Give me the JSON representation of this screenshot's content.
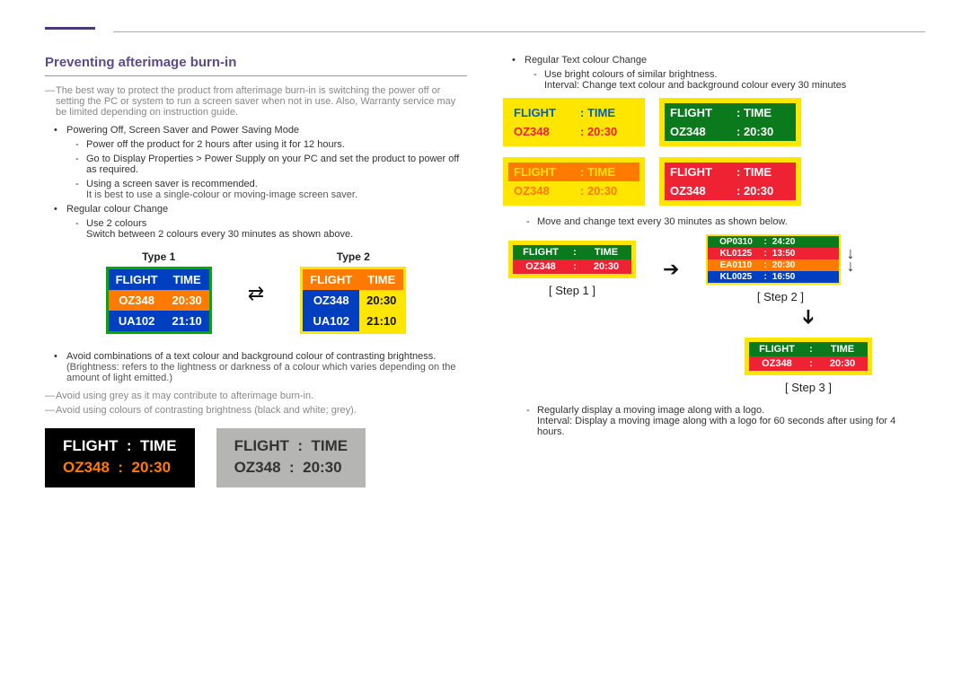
{
  "title": "Preventing afterimage burn-in",
  "intro": "The best way to protect the product from afterimage burn-in is switching the power off or setting the PC or system to run a screen saver when not in use. Also, Warranty service may be limited depending on instruction guide.",
  "b1": "Powering Off, Screen Saver and Power Saving Mode",
  "b1s1": "Power off the product for 2 hours after using it for 12 hours.",
  "b1s2": "Go to Display Properties > Power Supply on your PC and set the product to power off as required.",
  "b1s3": "Using a screen saver is recommended.",
  "b1s3n": "It is best to use a single-colour or moving-image screen saver.",
  "b2": "Regular colour Change",
  "b2s1": "Use 2 colours",
  "b2s1n": "Switch between 2 colours every 30 minutes as shown above.",
  "type1": "Type 1",
  "type2": "Type 2",
  "tbl": {
    "h1": "FLIGHT",
    "h2": "TIME",
    "r1c1": "OZ348",
    "r1c2": "20:30",
    "r2c1": "UA102",
    "r2c2": "21:10"
  },
  "b3": "Avoid combinations of a text colour and background colour of contrasting brightness.",
  "b3n": "(Brightness: refers to the lightness or darkness of a colour which varies depending on the amount of light emitted.)",
  "warn1": "Avoid using grey as it may contribute to afterimage burn-in.",
  "warn2": "Avoid using colours of contrasting brightness (black and white; grey).",
  "bw": {
    "l1a": "FLIGHT",
    "l1b": "TIME",
    "l2a": "OZ348",
    "l2b": "20:30"
  },
  "rc": {
    "title": "Regular Text colour Change",
    "s1": "Use bright colours of similar brightness.",
    "s1n": "Interval: Change text colour and background colour every 30 minutes",
    "s2": "Move and change text every 30 minutes as shown below.",
    "s3": "Regularly display a moving image along with a logo.",
    "s3n": "Interval: Display a moving image along with a logo for 60 seconds after using for 4 hours."
  },
  "card": {
    "h1": "FLIGHT",
    "h2": "TIME",
    "r1": "OZ348",
    "r2": "20:30"
  },
  "step1": "[ Step 1 ]",
  "step2": "[ Step 2 ]",
  "step3": "[ Step 3 ]",
  "scroll": {
    "l1a": "OP0310",
    "l1b": "24:20",
    "l2a": "KL0125",
    "l2b": "13:50",
    "l3a": "EA0110",
    "l3b": "20:30",
    "l4a": "KL0025",
    "l4b": "16:50"
  }
}
